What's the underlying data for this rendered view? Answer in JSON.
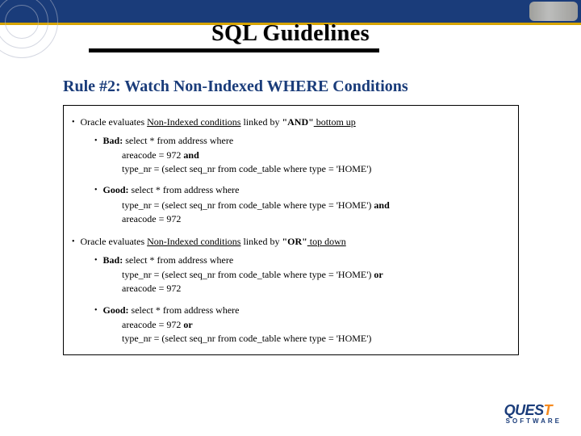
{
  "header": {
    "title": "SQL Guidelines"
  },
  "subtitle": "Rule #2: Watch Non-Indexed WHERE Conditions",
  "content": {
    "rule_and_prefix": "Oracle evaluates ",
    "rule_and_mid": "Non-Indexed conditions",
    "rule_and_suffix1": " linked by ",
    "rule_and_bold": "\"AND\"",
    "rule_and_dir": " bottom up",
    "and_bad_label": "Bad:",
    "and_bad_l1": " select * from address where",
    "and_bad_l2_a": "areacode = 972 ",
    "and_bad_l2_b": "and",
    "and_bad_l3": "type_nr = (select seq_nr from code_table where type = 'HOME')",
    "and_good_label": "Good:",
    "and_good_l1": " select * from address where",
    "and_good_l2_a": "type_nr = (select seq_nr from code_table where type = 'HOME') ",
    "and_good_l2_b": "and",
    "and_good_l3": "areacode = 972",
    "rule_or_prefix": "Oracle evaluates ",
    "rule_or_mid": "Non-Indexed conditions",
    "rule_or_suffix1": " linked by ",
    "rule_or_bold": "\"OR\"",
    "rule_or_dir": " top down",
    "or_bad_label": "Bad:",
    "or_bad_l1": " select * from address where",
    "or_bad_l2_a": "type_nr = (select seq_nr from code_table where type = 'HOME') ",
    "or_bad_l2_b": "or",
    "or_bad_l3": "areacode = 972",
    "or_good_label": "Good:",
    "or_good_l1": " select * from address where",
    "or_good_l2_a": "areacode = 972 ",
    "or_good_l2_b": "or",
    "or_good_l3": "type_nr = (select seq_nr from code_table where type = 'HOME')"
  },
  "footer": {
    "logo_main_1": "QUES",
    "logo_main_2": "T",
    "logo_sub": "SOFTWARE"
  }
}
